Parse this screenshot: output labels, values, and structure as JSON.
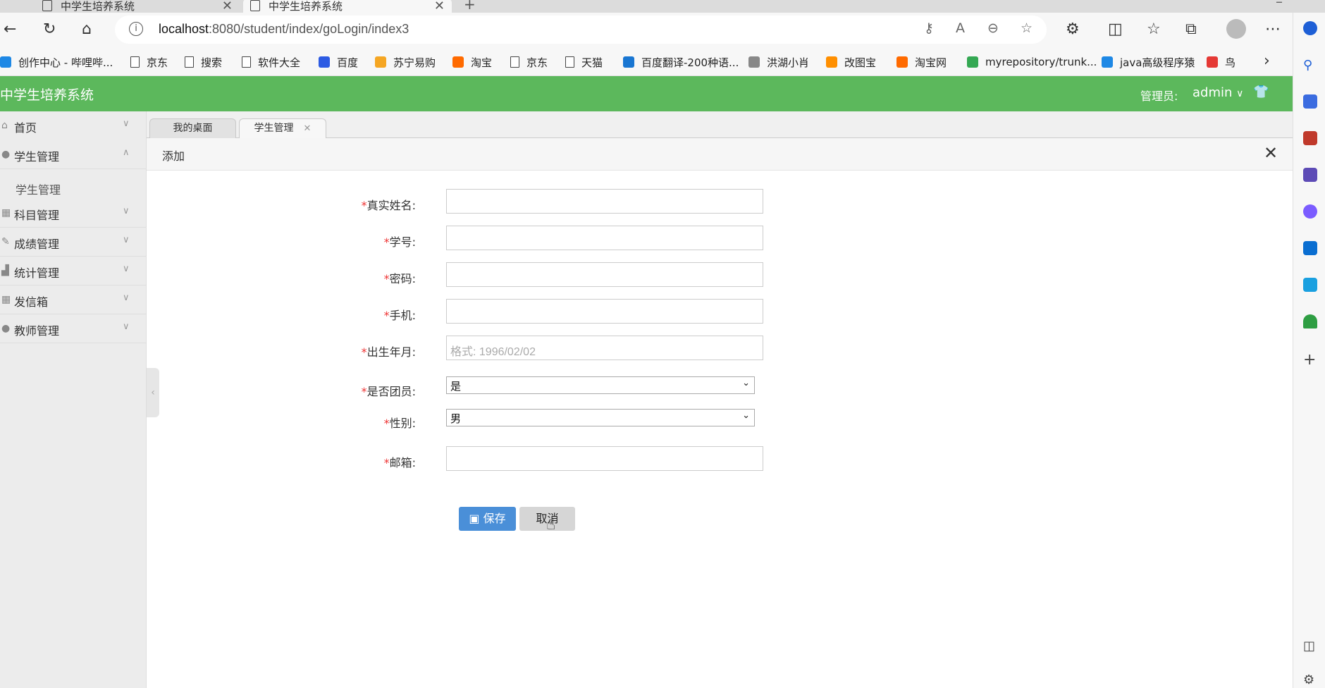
{
  "browser": {
    "tabs": [
      {
        "title": "中学生培养系统"
      },
      {
        "title": "中学生培养系统"
      }
    ],
    "url_host": "localhost",
    "url_path": ":8080/student/index/goLogin/index3",
    "bookmarks": [
      {
        "label": "创作中心 - 哔哩哔...",
        "color": "#1e88e5"
      },
      {
        "label": "京东",
        "color": "doc"
      },
      {
        "label": "搜索",
        "color": "doc"
      },
      {
        "label": "软件大全",
        "color": "doc"
      },
      {
        "label": "百度",
        "color": "#2d5be3"
      },
      {
        "label": "苏宁易购",
        "color": "#f5a623"
      },
      {
        "label": "淘宝",
        "color": "#ff6a00"
      },
      {
        "label": "京东",
        "color": "doc"
      },
      {
        "label": "天猫",
        "color": "doc"
      },
      {
        "label": "百度翻译-200种语...",
        "color": "#1976d2"
      },
      {
        "label": "洪湖小肖",
        "color": "#888888"
      },
      {
        "label": "改图宝",
        "color": "#ff8f00"
      },
      {
        "label": "淘宝网",
        "color": "#ff6a00"
      },
      {
        "label": "myrepository/trunk...",
        "color": "#34a853"
      },
      {
        "label": "java高级程序猿",
        "color": "#1e88e5"
      },
      {
        "label": "鸟",
        "color": "#e53935"
      }
    ]
  },
  "app": {
    "brand": "中学生培养系统",
    "admin_label": "管理员:",
    "admin_user": "admin",
    "accent": "#5cb85c",
    "menu": [
      {
        "label": "首页",
        "icon": "home-icon"
      },
      {
        "label": "学生管理",
        "icon": "user-icon"
      },
      {
        "label": "科目管理",
        "icon": "grid-icon"
      },
      {
        "label": "成绩管理",
        "icon": "edit-icon"
      },
      {
        "label": "统计管理",
        "icon": "chart-icon"
      },
      {
        "label": "发信箱",
        "icon": "grid-icon"
      },
      {
        "label": "教师管理",
        "icon": "user-icon"
      }
    ],
    "submenu_student": "学生管理",
    "page_tabs": [
      {
        "label": "我的桌面"
      },
      {
        "label": "学生管理"
      }
    ],
    "panel_title": "添加",
    "form": {
      "required_mark": "*",
      "realname_label": "真实姓名:",
      "studentno_label": "学号:",
      "password_label": "密码:",
      "phone_label": "手机:",
      "birth_label": "出生年月:",
      "birth_placeholder": "格式: 1996/02/02",
      "league_label": "是否团员:",
      "league_value": "是",
      "gender_label": "性别:",
      "gender_value": "男",
      "email_label": "邮箱:"
    },
    "save_label": "保存",
    "cancel_label": "取消"
  }
}
